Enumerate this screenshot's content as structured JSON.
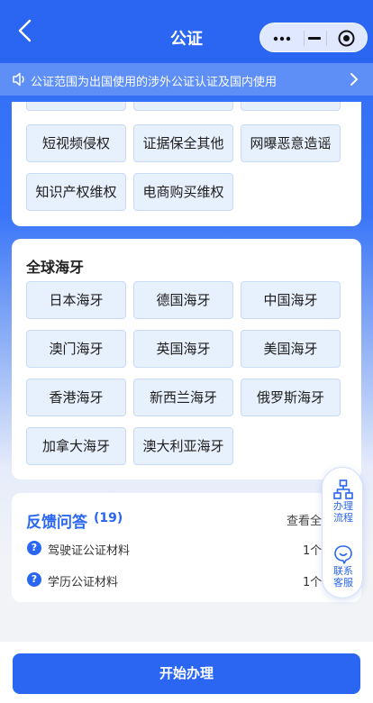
{
  "header": {
    "title": "公证",
    "accent_color": "#2b66f3"
  },
  "notice": {
    "text": "公证范围为出国使用的涉外公证认证及国内使用"
  },
  "top_section": {
    "chips": [
      "短视频侵权",
      "证据保全其他",
      "网曝恶意造谣",
      "知识产权维权",
      "电商购买维权"
    ]
  },
  "global_section": {
    "title": "全球海牙",
    "chips": [
      "日本海牙",
      "德国海牙",
      "中国海牙",
      "澳门海牙",
      "英国海牙",
      "美国海牙",
      "香港海牙",
      "新西兰海牙",
      "俄罗斯海牙",
      "加拿大海牙",
      "澳大利亚海牙"
    ]
  },
  "feedback": {
    "title": "反馈问答",
    "count": "(19)",
    "more": "查看全",
    "items": [
      {
        "label": "驾驶证公证材料",
        "count": "1个"
      },
      {
        "label": "学历公证材料",
        "count": "1个"
      }
    ],
    "q_icon": "?"
  },
  "float_panel": {
    "process_label_1": "办理",
    "process_label_2": "流程",
    "service_label_1": "联系",
    "service_label_2": "客服"
  },
  "bottom": {
    "start_label": "开始办理"
  }
}
